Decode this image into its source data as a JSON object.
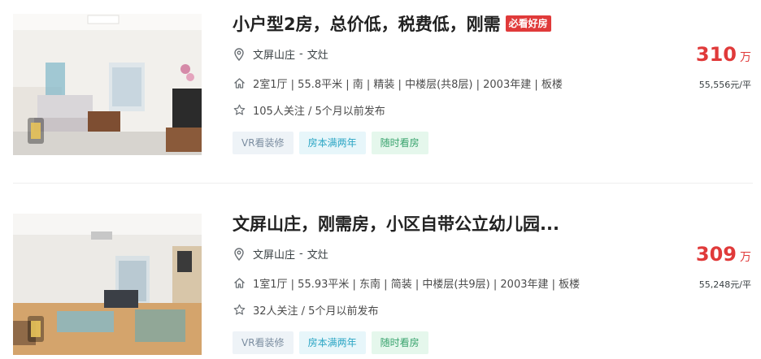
{
  "listings": [
    {
      "title": "小户型2房，总价低，税费低，刚需",
      "badge": "必看好房",
      "community": "文屏山庄",
      "district": "文灶",
      "separator": "-",
      "house_info": "2室1厅 | 55.8平米 | 南 | 精装 | 中楼层(共8层) | 2003年建 | 板楼",
      "follow_info": "105人关注 / 5个月以前发布",
      "tags": [
        "VR看装修",
        "房本满两年",
        "随时看房"
      ],
      "total_price": "310",
      "price_unit": "万",
      "unit_price": "55,556元/平"
    },
    {
      "title": "文屏山庄，刚需房，小区自带公立幼儿园...",
      "badge": "",
      "community": "文屏山庄",
      "district": "文灶",
      "separator": "-",
      "house_info": "1室1厅 | 55.93平米 | 东南 | 简装 | 中楼层(共9层) | 2003年建 | 板楼",
      "follow_info": "32人关注 / 5个月以前发布",
      "tags": [
        "VR看装修",
        "房本满两年",
        "随时看房"
      ],
      "total_price": "309",
      "price_unit": "万",
      "unit_price": "55,248元/平"
    }
  ],
  "colors": {
    "accent_red": "#e03a3a",
    "title": "#222222",
    "text": "#4b4b4b"
  },
  "icons": {
    "location": "location-pin-icon",
    "house": "house-icon",
    "follow": "star-icon"
  }
}
